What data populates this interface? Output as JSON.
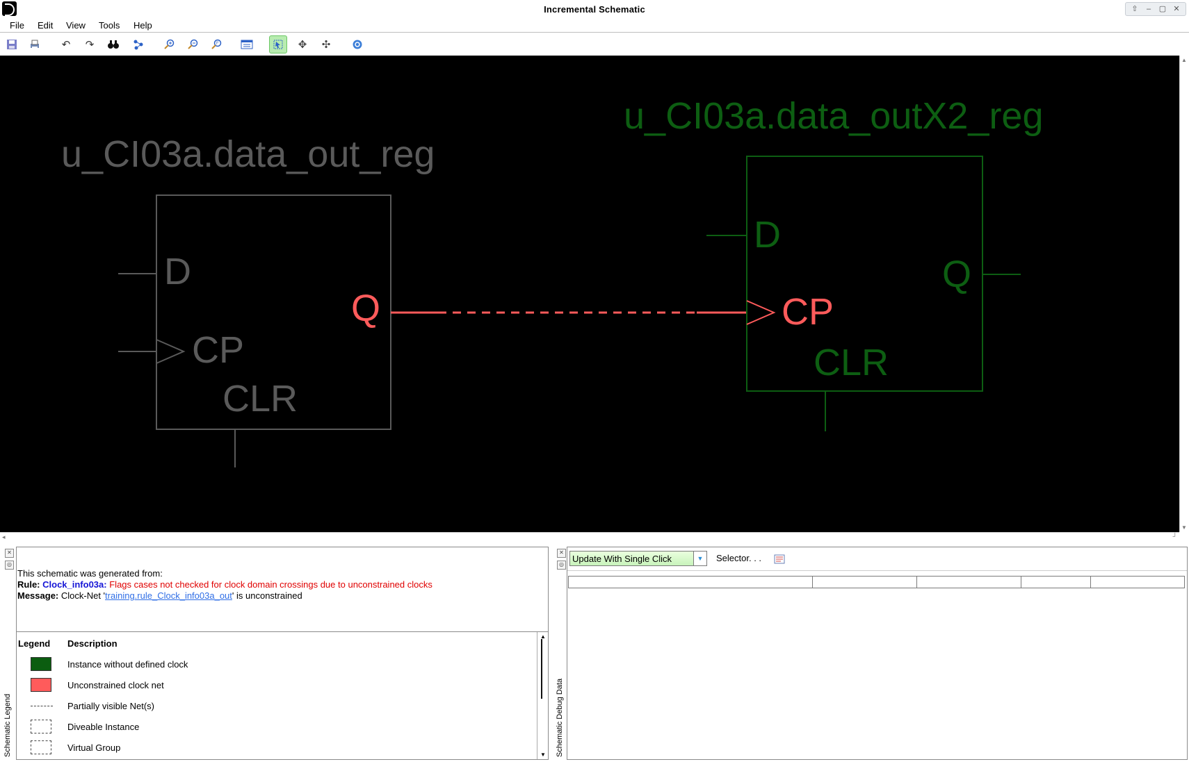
{
  "window": {
    "title": "Incremental Schematic"
  },
  "menu": [
    "File",
    "Edit",
    "View",
    "Tools",
    "Help"
  ],
  "toolbar_icons": [
    "save-icon",
    "print-icon",
    "undo-icon",
    "redo-icon",
    "binoculars-icon",
    "trace-icon",
    "zoom-in-icon",
    "zoom-out-icon",
    "zoom-fit-icon",
    "properties-icon",
    "select-mode-icon",
    "pan-icon",
    "expand-icon",
    "help-icon"
  ],
  "schematic": {
    "inst1": {
      "name": "u_CI03a.data_out_reg",
      "pin_d": "D",
      "pin_cp": "CP",
      "pin_clr": "CLR",
      "pin_q": "Q",
      "color": "#5a5a5a"
    },
    "inst2": {
      "name": "u_CI03a.data_outX2_reg",
      "pin_d": "D",
      "pin_cp": "CP",
      "pin_clr": "CLR",
      "pin_q": "Q",
      "color": "#0d5e12"
    },
    "net_color": "#ff5b5b"
  },
  "message": {
    "intro": "This schematic was generated from:",
    "rule_label": "Rule:",
    "rule_name": "Clock_info03a:",
    "rule_desc": "Flags cases not checked for clock domain crossings due to unconstrained clocks",
    "msg_label": "Message:",
    "msg_pre": "Clock-Net '",
    "msg_link": "training.rule_Clock_info03a_out",
    "msg_post": "' is unconstrained"
  },
  "legend": {
    "panel_title": "Schematic Legend",
    "col_legend": "Legend",
    "col_desc": "Description",
    "items": [
      {
        "desc": "Instance without defined clock",
        "swatch": "#0b5d10"
      },
      {
        "desc": "Unconstrained clock net",
        "swatch": "#ff5b5b"
      },
      {
        "desc": "Partially visible Net(s)"
      },
      {
        "desc": "Diveable Instance"
      },
      {
        "desc": "Virtual Group"
      }
    ]
  },
  "debug": {
    "panel_title": "Schematic Debug Data",
    "dropdown_value": "Update With Single Click",
    "selector_label": "Selector. . ."
  }
}
